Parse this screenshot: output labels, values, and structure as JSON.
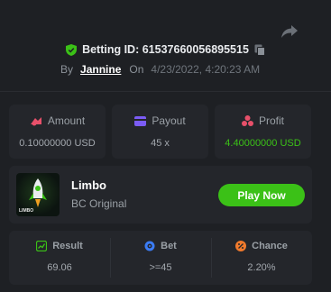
{
  "header": {
    "betting_id_label": "Betting ID:",
    "betting_id": "61537660056895515",
    "by_label": "By",
    "user": "Jannine",
    "on_label": "On",
    "date": "4/23/2022, 4:20:23 AM"
  },
  "stats": {
    "amount": {
      "label": "Amount",
      "value": "0.10000000 USD"
    },
    "payout": {
      "label": "Payout",
      "value": "45 x"
    },
    "profit": {
      "label": "Profit",
      "value": "4.40000000 USD"
    }
  },
  "game": {
    "thumbnail_text": "LIMBO",
    "name": "Limbo",
    "subtitle": "BC Original",
    "play_label": "Play Now"
  },
  "results": {
    "result": {
      "label": "Result",
      "value": "69.06"
    },
    "bet": {
      "label": "Bet",
      "value": ">=45"
    },
    "chance": {
      "label": "Chance",
      "value": "2.20%"
    }
  },
  "colors": {
    "background": "#1e2024",
    "card": "#24262b",
    "accent_green": "#3bc117",
    "amount_icon": "#e8506a",
    "payout_icon": "#7b5cf5",
    "profit_icon": "#e8506a",
    "bet_icon": "#3b7cf5",
    "chance_icon": "#f07a2c"
  },
  "icons": {
    "share": "share-icon",
    "shield": "shield-check-icon",
    "copy": "copy-icon",
    "amount": "coins-icon",
    "payout": "wallet-icon",
    "profit": "profit-icon",
    "result": "result-icon",
    "bet": "target-icon",
    "chance": "percent-icon"
  }
}
